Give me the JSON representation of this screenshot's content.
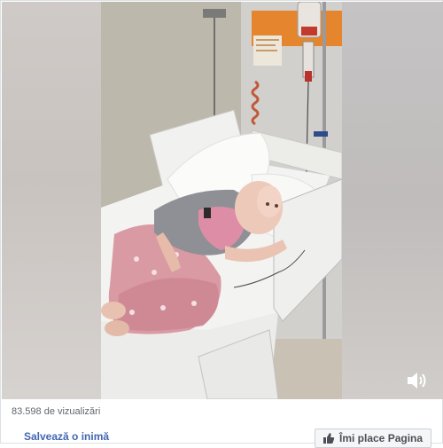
{
  "video": {
    "volume_icon": "volume-icon"
  },
  "stats": {
    "views_text": "83.598 de vizualizări"
  },
  "page": {
    "name": "Salvează o inimă"
  },
  "like": {
    "label": "Îmi place Pagina",
    "icon": "thumbs-up-icon"
  },
  "colors": {
    "link": "#4267b2",
    "secondary_text": "#606770",
    "button_bg": "#f5f6f7"
  }
}
